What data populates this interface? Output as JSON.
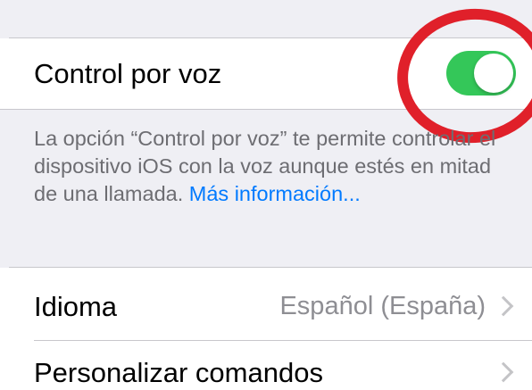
{
  "voice_control": {
    "label": "Control por voz",
    "toggle_state": "on",
    "toggle_color": "#34c759"
  },
  "footer": {
    "text": "La opción “Control por voz” te permite controlar el dispositivo iOS con la voz aunque estés en mitad de una llamada.",
    "link": "Más información..."
  },
  "language_row": {
    "label": "Idioma",
    "value": "Español (España)",
    "icon": "chevron-right-icon"
  },
  "commands_row": {
    "label": "Personalizar comandos",
    "icon": "chevron-right-icon"
  },
  "annotation": {
    "color": "#e0202a"
  }
}
